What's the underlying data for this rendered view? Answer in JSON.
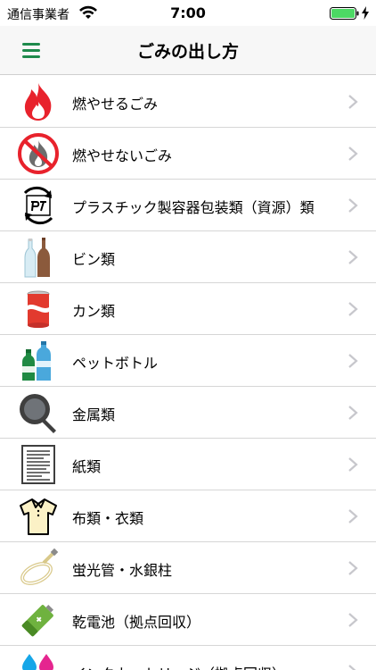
{
  "status": {
    "carrier": "通信事業者",
    "time": "7:00"
  },
  "nav": {
    "title": "ごみの出し方"
  },
  "categories": [
    {
      "label": "燃やせるごみ",
      "icon": "fire-icon"
    },
    {
      "label": "燃やせないごみ",
      "icon": "no-fire-icon"
    },
    {
      "label": "プラスチック製容器包装類（資源）類",
      "icon": "plastic-recycle-icon"
    },
    {
      "label": "ビン類",
      "icon": "bottles-icon"
    },
    {
      "label": "カン類",
      "icon": "can-icon"
    },
    {
      "label": "ペットボトル",
      "icon": "pet-bottle-icon"
    },
    {
      "label": "金属類",
      "icon": "frying-pan-icon"
    },
    {
      "label": "紙類",
      "icon": "paper-icon"
    },
    {
      "label": "布類・衣類",
      "icon": "shirt-icon"
    },
    {
      "label": "蛍光管・水銀柱",
      "icon": "fluorescent-tube-icon"
    },
    {
      "label": "乾電池（拠点回収）",
      "icon": "battery-icon"
    },
    {
      "label": "インクカートリッジ（拠点回収）",
      "icon": "ink-cartridge-icon"
    }
  ],
  "colors": {
    "accent": "#1e8a4c",
    "separator": "#d6d6d6",
    "chevron": "#c7c7cc",
    "nav_background": "#f7f7f7"
  }
}
